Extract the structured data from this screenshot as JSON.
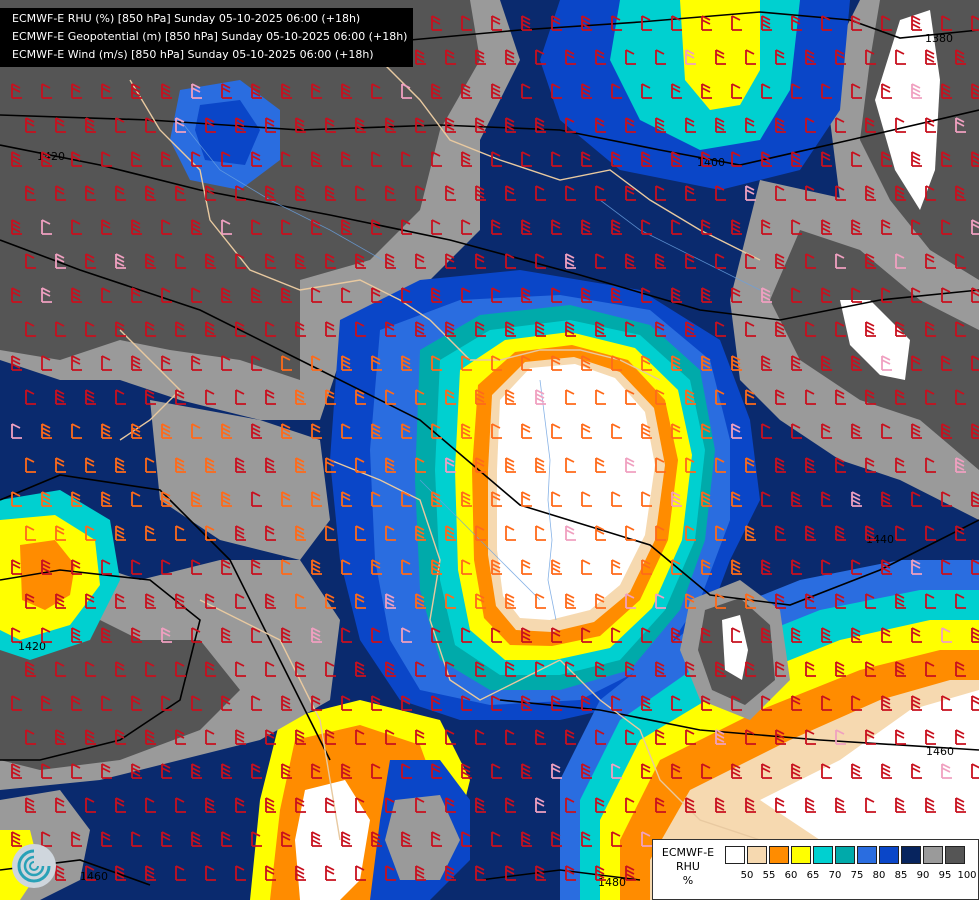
{
  "header": {
    "line1": "ECMWF-E RHU (%) [850 hPa] Sunday 05-10-2025 06:00 (+18h)",
    "line2": "ECMWF-E Geopotential (m) [850 hPa] Sunday 05-10-2025 06:00 (+18h)",
    "line3": "ECMWF-E Wind (m/s) [850 hPa] Sunday 05-10-2025 06:00 (+18h)"
  },
  "contour_labels": [
    "1380",
    "1400",
    "1420",
    "1420",
    "1440",
    "1460",
    "1460",
    "1480"
  ],
  "legend": {
    "title_line1": "ECMWF-E",
    "title_line2": "RHU",
    "title_line3": "%",
    "ticks": [
      "50",
      "55",
      "60",
      "65",
      "70",
      "75",
      "80",
      "85",
      "90",
      "95",
      "100"
    ],
    "colors": [
      "#ffffff",
      "#f6d9b0",
      "#ff8c00",
      "#ffff00",
      "#00d0d0",
      "#00aaaa",
      "#2a6de0",
      "#0a46c8",
      "#07245e",
      "#9a9a9a",
      "#555555"
    ]
  },
  "logo_icon": "ecmwf-swirl-icon"
}
